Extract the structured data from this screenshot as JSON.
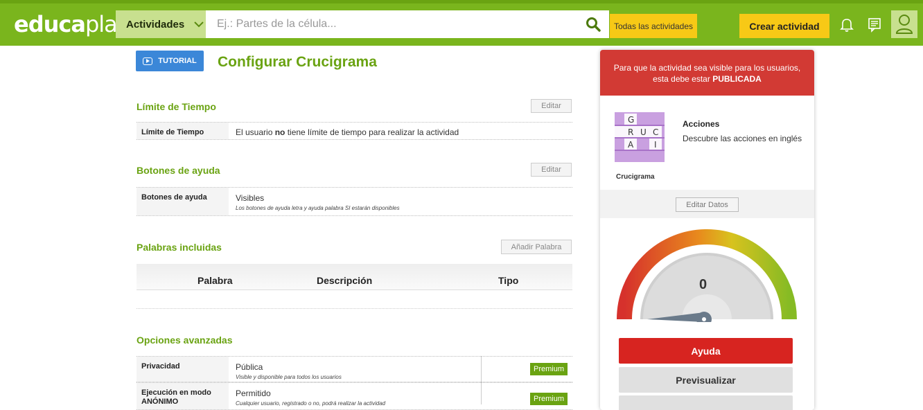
{
  "header": {
    "logo_bold": "educa",
    "logo_thin": "play",
    "activities_dropdown": "Actividades",
    "search_placeholder": "Ej.: Partes de la célula...",
    "all_activities": "Todas las actividades",
    "create_activity": "Crear actividad"
  },
  "main": {
    "tutorial": "TUTORIAL",
    "title": "Configurar Crucigrama",
    "time_limit": {
      "title": "Límite de Tiempo",
      "edit": "Editar",
      "key": "Límite de Tiempo",
      "value_pre": "El usuario ",
      "value_bold": "no",
      "value_post": " tiene límite de tiempo para realizar la actividad"
    },
    "help_buttons": {
      "title": "Botones de ayuda",
      "edit": "Editar",
      "key": "Botones de ayuda",
      "value": "Visibles",
      "subvalue": "Los botones de ayuda letra y ayuda palabra SI estarán disponibles"
    },
    "words": {
      "title": "Palabras incluidas",
      "add": "Añadir Palabra",
      "columns": [
        "Palabra",
        "Descripción",
        "Tipo"
      ]
    },
    "advanced": {
      "title": "Opciones avanzadas",
      "rows": [
        {
          "key": "Privacidad",
          "value": "Pública",
          "subvalue": "Visible y disponible para todos los usuarios",
          "badge": "Premium"
        },
        {
          "key": "Ejecución en modo ANÓNIMO",
          "value": "Permitido",
          "subvalue": "Cualquier usuario, registrado o no, podrá realizar la actividad",
          "badge": "Premium"
        }
      ]
    }
  },
  "panel": {
    "notice_pre": "Para que la actividad sea visible para los usuarios, esta debe estar ",
    "notice_bold": "PUBLICADA",
    "activity_type": "Crucigrama",
    "activity_title": "Acciones",
    "activity_desc": "Descubre las acciones en inglés",
    "edit_data": "Editar Datos",
    "gauge_value": "0",
    "help_button": "Ayuda",
    "preview_button": "Previsualizar",
    "thumbnail_letters": [
      "G",
      "R",
      "U",
      "C",
      "A",
      "I"
    ]
  },
  "colors": {
    "brand_green": "#7ab51d",
    "accent_yellow": "#f7c916",
    "alert_red": "#d23a34",
    "title_green": "#6aa312"
  }
}
